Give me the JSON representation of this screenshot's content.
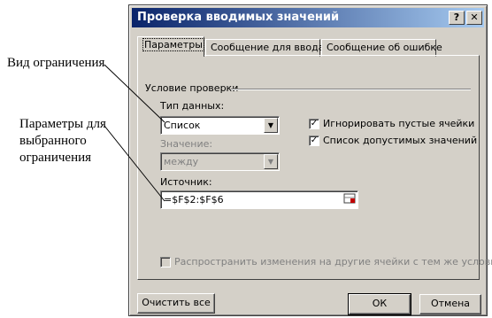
{
  "callouts": {
    "validation_type": "Вид ограничения",
    "criteria_params": [
      "Параметры для",
      "выбранного",
      "ограничения"
    ]
  },
  "dialog": {
    "title": "Проверка вводимых значений",
    "help_glyph": "?",
    "close_glyph": "✕",
    "tabs": [
      "Параметры",
      "Сообщение для ввода",
      "Сообщение об ошибке"
    ],
    "group_title": "Условие проверки",
    "allow_label": "Тип данных:",
    "allow_value": "Список",
    "data_label": "Значение:",
    "data_value": "между",
    "source_label": "Источник:",
    "source_value": "=$F$2:$F$6",
    "ignore_blank_label": "Игнорировать пустые ячейки",
    "ignore_blank_checked": true,
    "dropdown_label": "Список допустимых значений",
    "dropdown_checked": true,
    "apply_all_label": "Распространить изменения на другие ячейки с тем же условием",
    "apply_all_checked": false,
    "clear_all_button": "Очистить все",
    "ok_button": "ОК",
    "cancel_button": "Отмена",
    "check_glyph": "✓",
    "dropdown_arrow": "▼"
  }
}
